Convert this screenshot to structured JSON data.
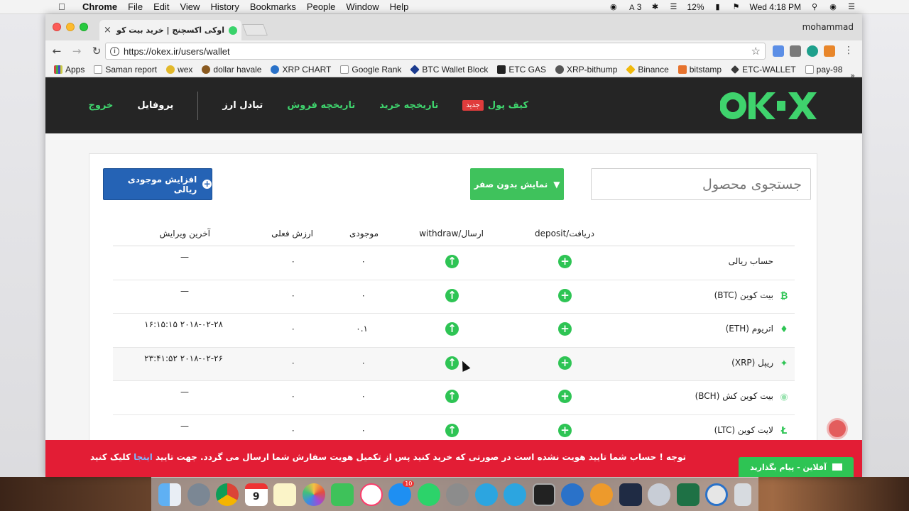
{
  "menubar": {
    "app_name": "Chrome",
    "items": [
      "File",
      "Edit",
      "View",
      "History",
      "Bookmarks",
      "People",
      "Window",
      "Help"
    ],
    "status": {
      "battery": "12%",
      "datetime": "Wed 4:18 PM",
      "adobe_count": "3"
    }
  },
  "browser": {
    "tab_title": "اوکی اکسچنج | خرید بیت کوین ارز",
    "profile_name": "mohammad",
    "url": "https://okex.ir/users/wallet",
    "bookmarks": [
      "Apps",
      "Saman report",
      "wex",
      "dollar havale",
      "XRP CHART",
      "Google Rank",
      "BTC Wallet Block",
      "ETC GAS",
      "XRP-bithump",
      "Binance",
      "bitstamp",
      "ETC-WALLET",
      "pay-98"
    ]
  },
  "header": {
    "nav": {
      "wallet": "کیف پول",
      "new_badge": "جدید",
      "purchase_history": "تاریخچه خرید",
      "sales_history": "تاریخچه فروش",
      "exchange": "تبادل ارز",
      "profile": "پروفایل",
      "logout": "خروج"
    },
    "logo_colors": {
      "primary": "#3fd36d"
    }
  },
  "wallet": {
    "search_placeholder": "جستجوی محصول",
    "filter_button": "نمایش بدون صفر",
    "add_balance_button": "افزایش موجودی ریالی",
    "columns": {
      "deposit": "دریافت/deposit",
      "withdraw": "ارسال/withdraw",
      "balance": "موجودی",
      "current_value": "ارزش فعلی",
      "last_edit": "آخرین ویرایش"
    },
    "rows": [
      {
        "name": "حساب ریالی",
        "balance": "۰",
        "value": "۰",
        "last_edit": "—",
        "icon": ""
      },
      {
        "name": "بیت کوین (BTC)",
        "balance": "۰",
        "value": "۰",
        "last_edit": "—",
        "icon": "bitcoin-icon"
      },
      {
        "name": "اتریوم (ETH)",
        "balance": "۰.۱",
        "value": "۰",
        "last_edit": "۲۰۱۸-۰۲-۲۸ ۱۶:۱۵:۱۵",
        "icon": "ethereum-icon"
      },
      {
        "name": "ریپل (XRP)",
        "balance": "۰",
        "value": "۰",
        "last_edit": "۲۰۱۸-۰۲-۲۶ ۲۳:۴۱:۵۲",
        "icon": "ripple-icon"
      },
      {
        "name": "بیت کوین کش (BCH)",
        "balance": "۰",
        "value": "۰",
        "last_edit": "—",
        "icon": "bitcoin-cash-icon"
      },
      {
        "name": "لایت کوین (LTC)",
        "balance": "۰",
        "value": "۰",
        "last_edit": "—",
        "icon": "litecoin-icon"
      }
    ]
  },
  "alert": {
    "text_before": "توجه ! حساب شما تایید هویت نشده است در صورتی که خرید کنید پس از تکمیل هویت سفارش شما ارسال می گردد. جهت تایید",
    "link_text": "اینجا",
    "text_after": "کلیک کنید",
    "chat_button": "آفلاین - پیام بگذارید"
  },
  "dock": {
    "calendar_day": "9",
    "appstore_badge": "10"
  }
}
